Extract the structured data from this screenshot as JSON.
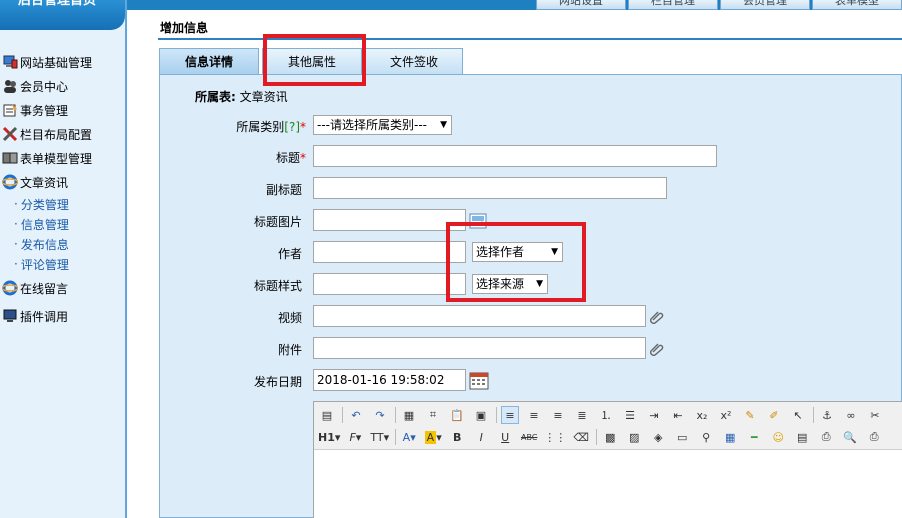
{
  "top_nav": [
    "网站设置",
    "栏目管理",
    "会员管理",
    "表单模型"
  ],
  "sidebar": {
    "logo": "后台管理首页",
    "items": [
      {
        "label": "网站基础管理",
        "icon": "computer-icon"
      },
      {
        "label": "会员中心",
        "icon": "users-icon"
      },
      {
        "label": "事务管理",
        "icon": "notepad-icon"
      },
      {
        "label": "栏目布局配置",
        "icon": "tools-icon"
      },
      {
        "label": "表单模型管理",
        "icon": "book-icon"
      },
      {
        "label": "文章资讯",
        "icon": "ie-icon"
      }
    ],
    "sub_items": [
      "分类管理",
      "信息管理",
      "发布信息",
      "评论管理"
    ],
    "items_bottom": [
      {
        "label": "在线留言",
        "icon": "ie-icon"
      },
      {
        "label": "插件调用",
        "icon": "monitor-icon"
      }
    ]
  },
  "main": {
    "title": "增加信息",
    "tabs": [
      "信息详情",
      "其他属性",
      "文件签收"
    ],
    "belong_table_label": "所属表:",
    "belong_table_value": "文章资讯",
    "fields": {
      "category_label": "所属类别",
      "category_help": "[?]",
      "category_required": "*",
      "category_value": "---请选择所属类别---",
      "title_label": "标题",
      "title_required": "*",
      "subtitle_label": "副标题",
      "title_image_label": "标题图片",
      "author_label": "作者",
      "author_select": "选择作者",
      "title_style_label": "标题样式",
      "source_select": "选择来源",
      "video_label": "视频",
      "attachment_label": "附件",
      "publish_date_label": "发布日期",
      "publish_date_value": "2018-01-16 19:58:02"
    },
    "editor": {
      "heading_btn": "H1",
      "font_btn": "F",
      "size_btn": "TT",
      "font_color_btn": "A",
      "bg_color_btn": "A",
      "bold": "B",
      "italic": "I",
      "underline": "U",
      "strike": "ABC"
    }
  },
  "colors": {
    "accent": "#1e7fc1",
    "panel_bg": "#dcecf9",
    "highlight": "#e01b23",
    "required": "#dd0000"
  }
}
